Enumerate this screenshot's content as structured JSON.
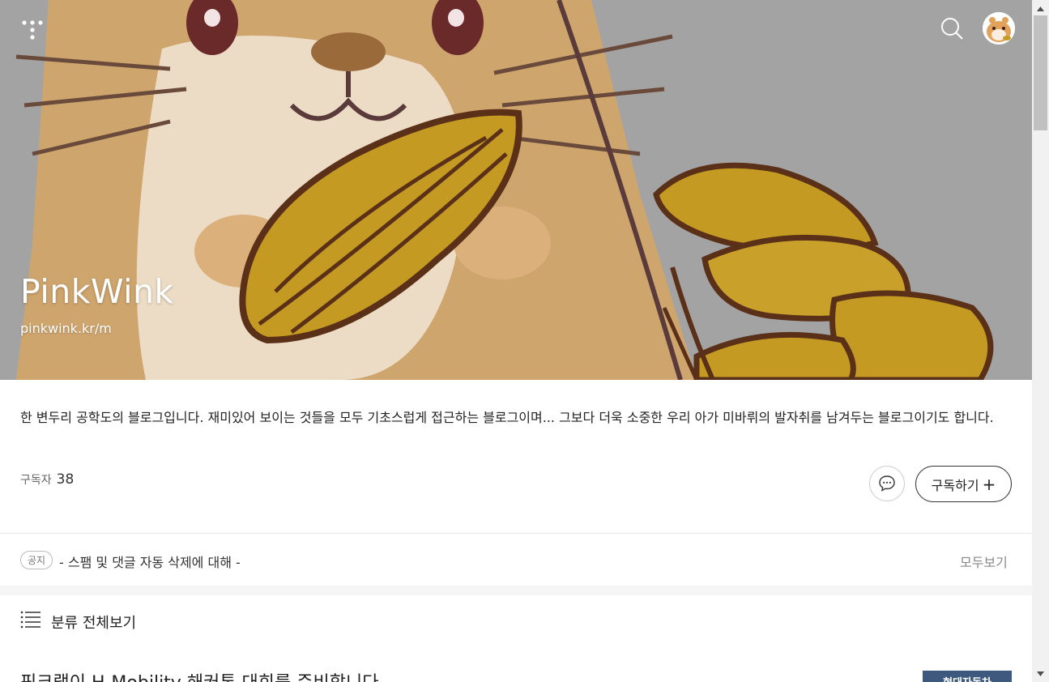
{
  "header": {
    "blog_title": "PinkWink",
    "blog_url": "pinkwink.kr/m",
    "icons": {
      "menu": "dots-menu-icon",
      "search": "search-icon",
      "avatar": "hamster-avatar"
    }
  },
  "profile": {
    "description": "한 변두리 공학도의 블로그입니다. 재미있어 보이는 것들을 모두 기초스럽게 접근하는 블로그이며... 그보다 더욱 소중한 우리 아가 미바뤼의 발자취를 남겨두는 블로그이기도 합니다.",
    "subscribers_label": "구독자",
    "subscribers_count": "38",
    "subscribe_label": "구독하기",
    "subscribe_plus": "+"
  },
  "notice": {
    "badge": "공지",
    "text": "- 스팸 및 댓글 자동 삭제에 대해 -",
    "view_all": "모두보기"
  },
  "category": {
    "label": "분류 전체보기"
  },
  "post": {
    "title": "핑크랩이 H-Mobility 해커톤 대회를 준비합니다",
    "thumb_text": "현대자동차"
  },
  "colors": {
    "hero_bg": "#9f9f9f",
    "thumb_bg": "#3d5a7e",
    "band": "#f5f5f5"
  }
}
